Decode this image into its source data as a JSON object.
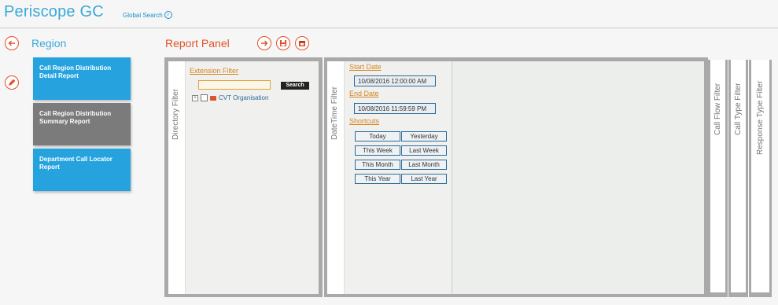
{
  "header": {
    "title": "Periscope GC",
    "global_search": "Global Search"
  },
  "left": {
    "section_title": "Region",
    "reports": [
      {
        "label": "Call Region Distribution Detail Report",
        "state": "active"
      },
      {
        "label": "Call Region Distribution Summary Report",
        "state": "inactive"
      },
      {
        "label": "Department Call Locator Report",
        "state": "active"
      }
    ]
  },
  "panel": {
    "title": "Report Panel"
  },
  "directory_filter": {
    "tab_label": "Directory Filter",
    "extension_filter_label": "Extension Filter",
    "search_placeholder": "",
    "search_button": "Search",
    "tree_item": "CVT Organisation"
  },
  "datetime_filter": {
    "tab_label": "DateTime Filter",
    "start_label": "Start Date",
    "start_value": "10/08/2016 12:00:00 AM",
    "end_label": "End Date",
    "end_value": "10/08/2016 11:59:59 PM",
    "shortcuts_label": "Shortcuts",
    "shortcuts": [
      "Today",
      "Yesterday",
      "This Week",
      "Last Week",
      "This Month",
      "Last Month",
      "This Year",
      "Last Year"
    ]
  },
  "other_tabs": [
    "Call Flow Filter",
    "Call Type Filter",
    "Response Type Filter"
  ],
  "colors": {
    "accent_blue": "#26a3df",
    "accent_orange": "#e0522b",
    "link_orange": "#d78321"
  }
}
